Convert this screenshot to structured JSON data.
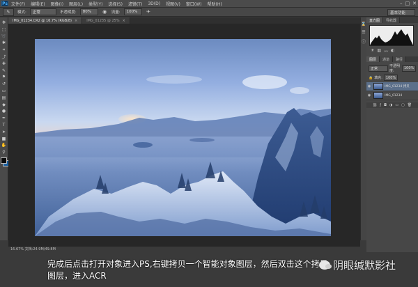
{
  "app": {
    "logo": "Ps",
    "menu": [
      "文件(F)",
      "编辑(E)",
      "图像(I)",
      "图层(L)",
      "类型(Y)",
      "选择(S)",
      "滤镜(T)",
      "3D(D)",
      "视图(V)",
      "窗口(W)",
      "帮助(H)"
    ],
    "window_controls": [
      "–",
      "□",
      "✕"
    ]
  },
  "options_bar": {
    "mode_label": "模式:",
    "mode_value": "正常",
    "opacity_label": "不透明度:",
    "opacity_value": "80%",
    "flow_label": "流量:",
    "flow_value": "100%",
    "workspace": "基本功能"
  },
  "tabs": [
    {
      "label": "IMG_01234.CR2 @ 16.7% (RGB/8)",
      "active": true
    },
    {
      "label": "IMG_01235 @ 25%",
      "active": false
    }
  ],
  "tools": [
    "move-icon",
    "marquee-icon",
    "lasso-icon",
    "quick-select-icon",
    "crop-icon",
    "eyedropper-icon",
    "healing-icon",
    "brush-icon",
    "clone-stamp-icon",
    "history-brush-icon",
    "eraser-icon",
    "gradient-icon",
    "blur-icon",
    "dodge-icon",
    "pen-icon",
    "type-icon",
    "path-select-icon",
    "shape-icon",
    "hand-icon",
    "zoom-icon"
  ],
  "status": "16.67%   文档:24.9M/49.8M",
  "panels": {
    "top_tabs": [
      "直方图",
      "导航器"
    ],
    "layer_tabs": [
      "图层",
      "通道",
      "路径"
    ],
    "blend_mode": "正常",
    "opacity_label": "不透明度:",
    "opacity_value": "100%",
    "fill_label": "填充:",
    "fill_value": "100%",
    "layers": [
      {
        "name": "IMG_01234 拷贝",
        "selected": true
      },
      {
        "name": "IMG_01234",
        "selected": false
      }
    ]
  },
  "subtitle": {
    "line1": "完成后点击打开对象进入PS,右键拷贝一个智能对象图层，然后双击这个拷贝",
    "line2": "图层，进入ACR"
  },
  "watermark": "阴眼缄默影社",
  "colors": {
    "accent": "#1a5fa0",
    "selected_layer": "#5b6f8a",
    "panel_bg": "#474747"
  }
}
